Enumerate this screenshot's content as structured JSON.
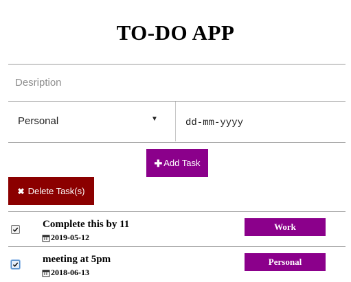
{
  "app": {
    "title": "TO-DO APP"
  },
  "form": {
    "description_placeholder": "Desription",
    "category_selected": "Personal",
    "date_placeholder": "dd-mm-yyyy",
    "add_label": "Add Task",
    "delete_label": "Delete Task(s)"
  },
  "icons": {
    "add": "plus-icon",
    "delete": "times-icon",
    "date": "calendar-icon",
    "select": "caret-down-icon"
  },
  "colors": {
    "accent": "#8b008b",
    "danger": "#8b0000"
  },
  "tasks": [
    {
      "title": "Complete this by 11",
      "date": "2019-05-12",
      "category": "Work",
      "checked": true
    },
    {
      "title": "meeting at 5pm",
      "date": "2018-06-13",
      "category": "Personal",
      "checked": true
    }
  ]
}
